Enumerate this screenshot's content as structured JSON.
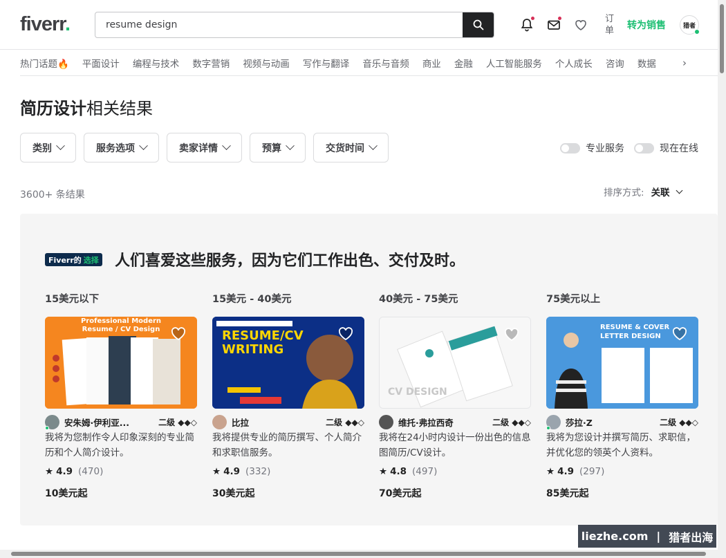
{
  "header": {
    "logo": "fiverr",
    "logo_dot": ".",
    "search_value": "resume design",
    "orders_label": "订单",
    "become_seller": "转为销售",
    "avatar_text": "猎者"
  },
  "categories": [
    "热门话题🔥",
    "平面设计",
    "编程与技术",
    "数字营销",
    "视频与动画",
    "写作与翻译",
    "音乐与音频",
    "商业",
    "金融",
    "人工智能服务",
    "个人成长",
    "咨询",
    "数据"
  ],
  "page": {
    "title_bold": "简历设计",
    "title_rest": "相关结果",
    "results_count": "3600+ 条结果",
    "sort_label": "排序方式:",
    "sort_value": "关联"
  },
  "filters": [
    "类别",
    "服务选项",
    "卖家详情",
    "预算",
    "交货时间"
  ],
  "toggles": [
    "专业服务",
    "现在在线"
  ],
  "choice": {
    "badge_a": "Fiverr的",
    "badge_b": "选择",
    "title": "人们喜爱这些服务，因为它们工作出色、交付及时。"
  },
  "gigs": [
    {
      "range": "15美元以下",
      "seller": "安朱姆·伊利亚...",
      "level": "二级 ◆◆◇",
      "desc": "我将为您制作令人印象深刻的专业简历和个人简介设计。",
      "rating": "4.9",
      "reviews": "(470)",
      "price": "10美元起",
      "thumb_text": "Professional Modern Resume / CV Design"
    },
    {
      "range": "15美元 - 40美元",
      "seller": "比拉",
      "level": "二级 ◆◆◇",
      "desc": "我将提供专业的简历撰写、个人简介和求职信服务。",
      "rating": "4.9",
      "reviews": "(332)",
      "price": "30美元起",
      "thumb_text": "RESUME/CV WRITING"
    },
    {
      "range": "40美元 - 75美元",
      "seller": "维托·弗拉西奇",
      "level": "二级 ◆◆◇",
      "desc": "我将在24小时内设计一份出色的信息图简历/CV设计。",
      "rating": "4.8",
      "reviews": "(497)",
      "price": "70美元起",
      "thumb_text": "CV DESIGN"
    },
    {
      "range": "75美元以上",
      "seller": "莎拉·Z",
      "level": "二级 ◆◆◇",
      "desc": "我将为您设计并撰写简历、求职信，并优化您的领英个人资料。",
      "rating": "4.9",
      "reviews": "(297)",
      "price": "85美元起",
      "thumb_text": "RESUME & COVER LETTER DESIGN"
    }
  ],
  "watermark": {
    "a": "liezhe.com",
    "b": "猎者出海"
  },
  "colors": {
    "brand": "#1dbf73",
    "dark": "#222325",
    "badge_bg": "#0d2b4c"
  }
}
